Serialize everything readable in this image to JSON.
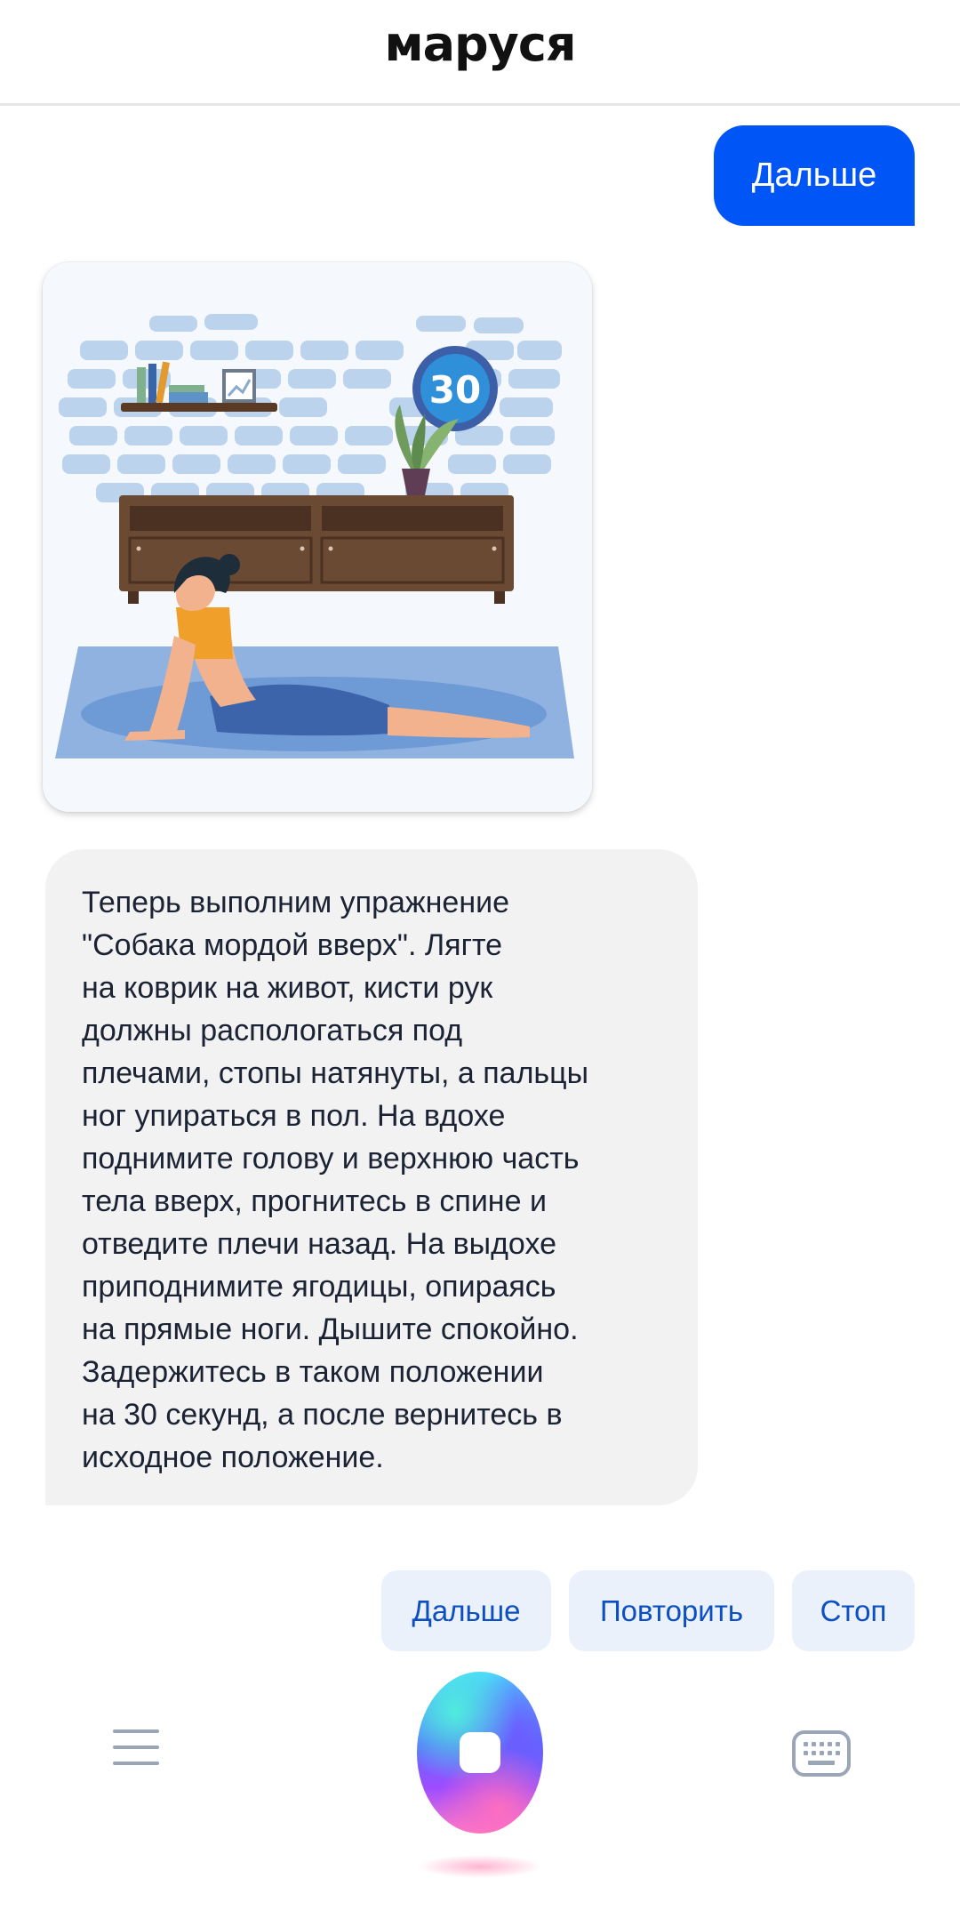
{
  "header": {
    "title": "маруся"
  },
  "messages": {
    "user": "Дальше",
    "assistant_image": {
      "timer_badge": "30"
    },
    "assistant_text": "Теперь выполним упражнение\n\"Собака мордой вверх\". Лягте\nна коврик на живот, кисти рук\nдолжны распологаться под\nплечами, стопы натянуты, а пальцы\nног упираться в пол. На вдохе\nподнимите голову и верхнюю часть\nтела вверх, прогнитесь в спине и\nотведите плечи назад. На выдохе\nприподнимите ягодицы, опираясь\nна прямые ноги. Дышите спокойно.\nЗадержитесь в таком положении\nна 30 секунд, а после вернитесь в\nисходное положение."
  },
  "suggestions": [
    "Дальше",
    "Повторить",
    "Стоп"
  ],
  "bottom_bar": {
    "left_icon": "menu-icon",
    "center_icon": "assistant-orb-stop",
    "right_icon": "keyboard-icon"
  },
  "colors": {
    "accent": "#0055f6",
    "chip_bg": "#ebf1fb",
    "chip_text": "#0b4fc2",
    "bubble_bg": "#f2f2f3"
  }
}
